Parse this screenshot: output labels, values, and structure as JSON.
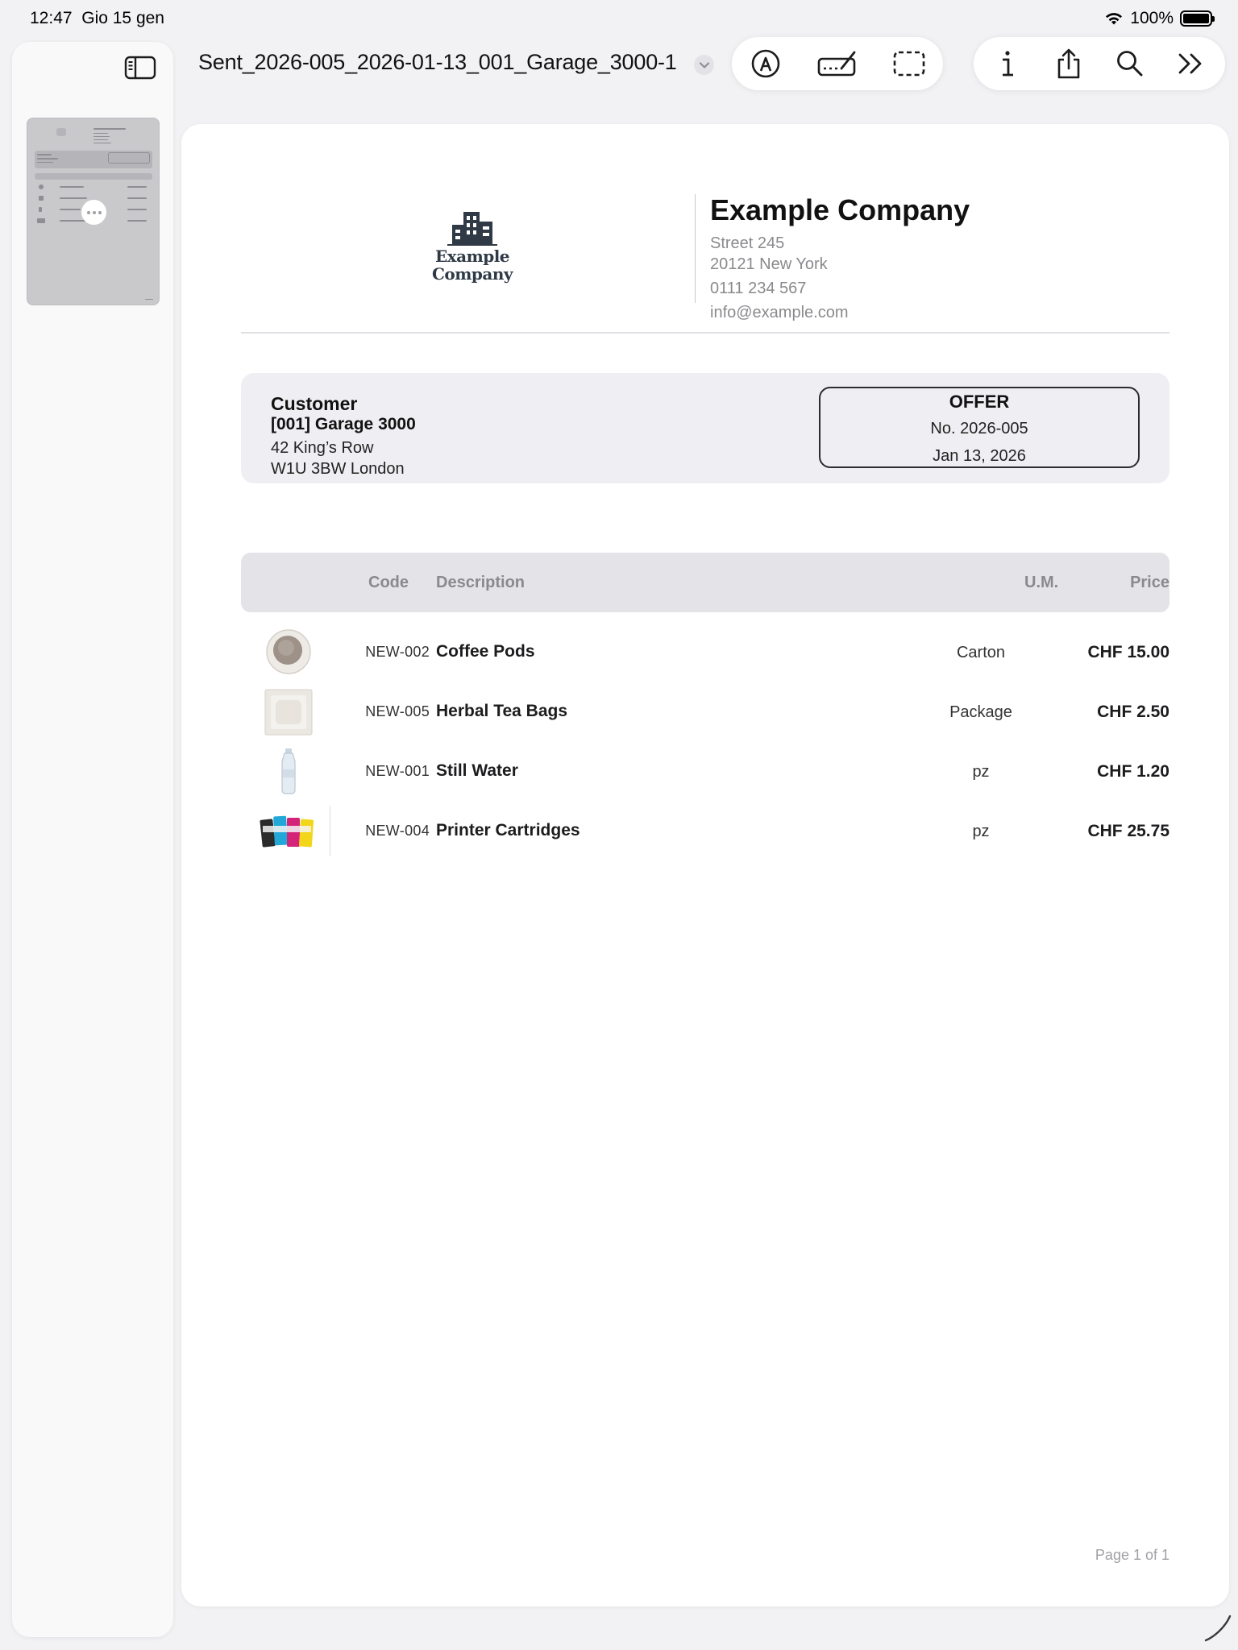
{
  "status_bar": {
    "time": "12:47",
    "date": "Gio 15 gen",
    "battery": "100%"
  },
  "sidebar": {
    "toggle_icon": "sidebar-icon",
    "thumbnail_page": 1
  },
  "document": {
    "title": "Sent_2026-005_2026-01-13_001_Garage_3000-1"
  },
  "toolbar": {
    "group1": [
      "markup-pen-icon",
      "signature-icon",
      "selection-rect-icon"
    ],
    "group2": [
      "info-icon",
      "share-icon",
      "search-icon",
      "more-chevrons-icon"
    ]
  },
  "page": {
    "logo": {
      "line1": "Example",
      "line2": "Company"
    },
    "company": {
      "name": "Example Company",
      "street": "Street 245",
      "city": "20121 New York",
      "phone": "0111 234 567",
      "email": "info@example.com"
    },
    "customer": {
      "heading": "Customer",
      "name": "[001] Garage 3000",
      "address1": "42 King’s Row",
      "address2": "W1U 3BW London"
    },
    "offer": {
      "title": "OFFER",
      "number": "No. 2026-005",
      "date": "Jan 13, 2026"
    },
    "table": {
      "headers": {
        "code": "Code",
        "description": "Description",
        "um": "U.M.",
        "price": "Price"
      },
      "rows": [
        {
          "image": "coffee-pod-image",
          "code": "NEW-002",
          "description": "Coffee Pods",
          "um": "Carton",
          "price": "CHF 15.00"
        },
        {
          "image": "tea-bag-image",
          "code": "NEW-005",
          "description": "Herbal Tea Bags",
          "um": "Package",
          "price": "CHF 2.50"
        },
        {
          "image": "water-bottle-image",
          "code": "NEW-001",
          "description": "Still Water",
          "um": "pz",
          "price": "CHF 1.20"
        },
        {
          "image": "printer-cartridges-image",
          "code": "NEW-004",
          "description": "Printer Cartridges",
          "um": "pz",
          "price": "CHF 25.75"
        }
      ]
    },
    "footer": "Page 1 of 1"
  }
}
